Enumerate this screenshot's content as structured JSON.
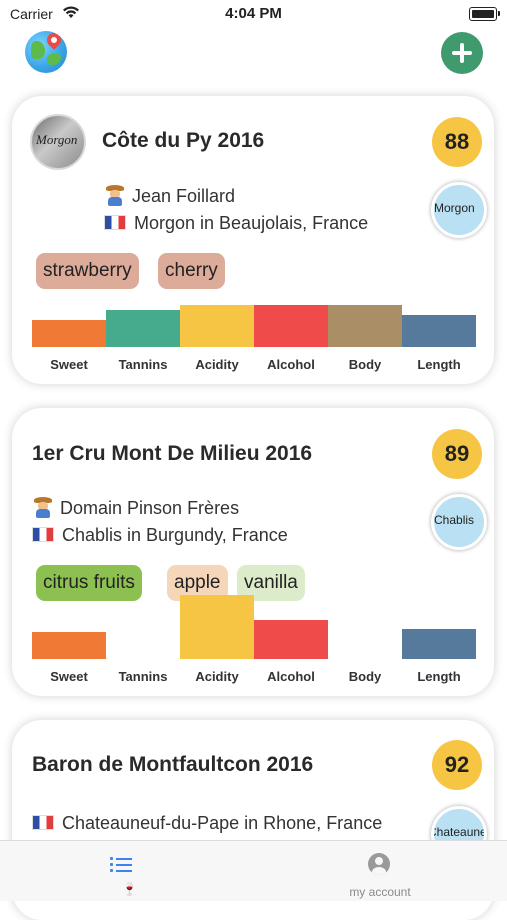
{
  "status_bar": {
    "carrier": "Carrier",
    "time": "4:04 PM"
  },
  "top_bar": {
    "left_icon": "globe-map-pin-icon",
    "right_icon": "plus-icon",
    "accent": "#3f9b6e"
  },
  "characteristics": [
    "Sweet",
    "Tannins",
    "Acidity",
    "Alcohol",
    "Body",
    "Length"
  ],
  "bar_colors": [
    "#f07a35",
    "#46ab8d",
    "#f6c543",
    "#f04b4b",
    "#a98e66",
    "#567a9b"
  ],
  "wines": [
    {
      "name": "Côte du Py 2016",
      "thumbnail_label": "Morgon",
      "score": "88",
      "producer": "Jean Foillard",
      "region": "Morgon in Beaujolais, France",
      "region_badge": "Morgon",
      "flavors": [
        {
          "label": "strawberry",
          "color": "#ddab99"
        },
        {
          "label": "cherry",
          "color": "#ddab99"
        }
      ],
      "profile_levels": [
        0.25,
        0.45,
        0.55,
        0.55,
        0.55,
        0.35
      ]
    },
    {
      "name": "1er Cru Mont De Milieu 2016",
      "score": "89",
      "producer": "Domain Pinson Frères",
      "region": "Chablis in Burgundy, France",
      "region_badge": "Chablis",
      "flavors": [
        {
          "label": "citrus fruits",
          "color": "#8cc152"
        },
        {
          "label": "apple",
          "color": "#f5d6b8"
        },
        {
          "label": "vanilla",
          "color": "#dceccb"
        }
      ],
      "profile_levels": [
        0.25,
        0.0,
        1.0,
        0.5,
        0.0,
        0.32
      ]
    },
    {
      "name": "Baron de Montfaultcon 2016",
      "score": "92",
      "region": "Chateauneuf-du-Pape in Rhone, France",
      "region_badge": "Chateauneuf-du-Pape"
    }
  ],
  "tab_bar": {
    "tab_list_icon": "list-icon",
    "account_label": "my account",
    "active_color": "#3b82f6"
  }
}
